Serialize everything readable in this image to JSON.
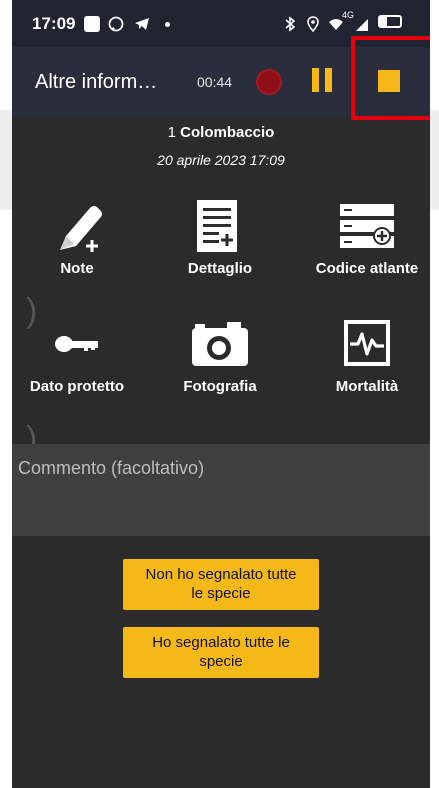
{
  "status_bar": {
    "time": "17:09",
    "network": "4G",
    "icons": [
      "square-icon",
      "whatsapp-icon",
      "telegram-icon",
      "dot-icon",
      "bluetooth-icon",
      "location-icon",
      "wifi-icon",
      "signal-icon",
      "battery-icon"
    ]
  },
  "app_bar": {
    "title": "Altre inform…",
    "timer": "00:44",
    "colors": {
      "accent": "#f5b819",
      "record": "#8e0f18",
      "highlight": "#e5000b"
    }
  },
  "observation": {
    "count": "1",
    "species": "Colombaccio",
    "date": "20 aprile 2023 17:09"
  },
  "tiles": [
    {
      "label": "Note",
      "icon": "pencil-plus-icon"
    },
    {
      "label": "Dettaglio",
      "icon": "document-plus-icon"
    },
    {
      "label": "Codice atlante",
      "icon": "list-plus-icon"
    },
    {
      "label": "Dato protetto",
      "icon": "key-icon"
    },
    {
      "label": "Fotografia",
      "icon": "camera-icon"
    },
    {
      "label": "Mortalità",
      "icon": "heartbeat-icon"
    }
  ],
  "comment": {
    "placeholder": "Commento (facoltativo)"
  },
  "buttons": {
    "not_all_line1": "Non ho segnalato tutte",
    "not_all_line2": "le specie",
    "all_line1": "Ho segnalato tutte le",
    "all_line2": "specie"
  }
}
